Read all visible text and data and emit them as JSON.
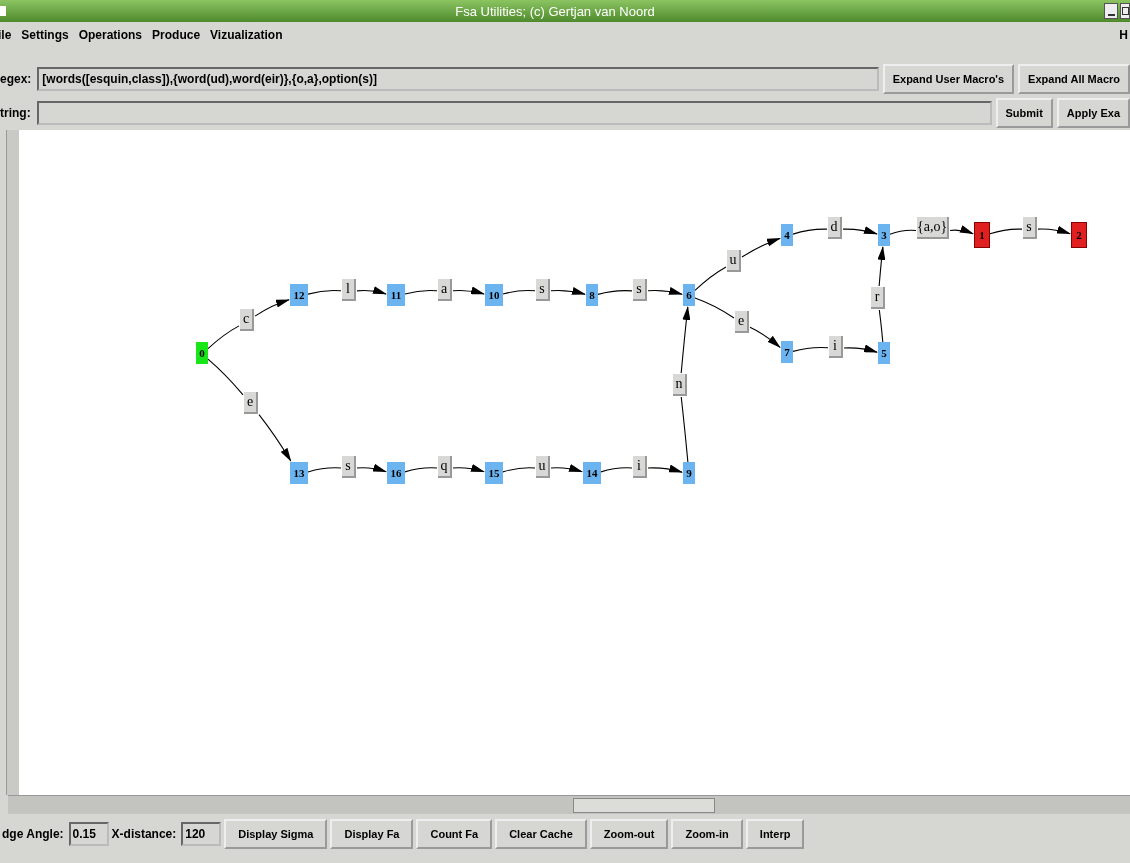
{
  "window": {
    "title": "Fsa Utilities; (c) Gertjan van Noord"
  },
  "menu": [
    {
      "label": "ile"
    },
    {
      "label": "Settings"
    },
    {
      "label": "Operations"
    },
    {
      "label": "Produce"
    },
    {
      "label": "Vizualization"
    }
  ],
  "help_menu": {
    "label": "H"
  },
  "regex": {
    "label": "egex:",
    "value": "[words([esquin,class]),{word(ud),word(eir)},{o,a},option(s)]",
    "buttons": [
      "Expand User Macro's",
      "Expand All Macro"
    ]
  },
  "string": {
    "label": "tring:",
    "buttons": [
      "Submit",
      "Apply Exa"
    ]
  },
  "graph": {
    "nodes": [
      {
        "label": "0",
        "kind": "start"
      },
      {
        "label": "12",
        "kind": "state"
      },
      {
        "label": "11",
        "kind": "state"
      },
      {
        "label": "10",
        "kind": "state"
      },
      {
        "label": "8",
        "kind": "state"
      },
      {
        "label": "6",
        "kind": "state"
      },
      {
        "label": "4",
        "kind": "state"
      },
      {
        "label": "3",
        "kind": "state"
      },
      {
        "label": "1",
        "kind": "final"
      },
      {
        "label": "2",
        "kind": "final"
      },
      {
        "label": "7",
        "kind": "state"
      },
      {
        "label": "5",
        "kind": "state"
      },
      {
        "label": "13",
        "kind": "state"
      },
      {
        "label": "16",
        "kind": "state"
      },
      {
        "label": "15",
        "kind": "state"
      },
      {
        "label": "14",
        "kind": "state"
      },
      {
        "label": "9",
        "kind": "state"
      }
    ],
    "edges": [
      {
        "label": "c"
      },
      {
        "label": "e"
      },
      {
        "label": "l"
      },
      {
        "label": "a"
      },
      {
        "label": "s"
      },
      {
        "label": "s"
      },
      {
        "label": "u"
      },
      {
        "label": "e"
      },
      {
        "label": "d"
      },
      {
        "label": "i"
      },
      {
        "label": "r"
      },
      {
        "label": "{a,o}"
      },
      {
        "label": "s"
      },
      {
        "label": "s"
      },
      {
        "label": "q"
      },
      {
        "label": "u"
      },
      {
        "label": "i"
      },
      {
        "label": "n"
      }
    ]
  },
  "toolbar": {
    "edge_angle": {
      "label": "dge Angle:",
      "value": "0.15"
    },
    "x_distance": {
      "label": "X-distance:",
      "value": "120"
    },
    "buttons": [
      "Display Sigma",
      "Display Fa",
      "Count Fa",
      "Clear Cache",
      "Zoom-out",
      "Zoom-in",
      "Interp"
    ]
  }
}
